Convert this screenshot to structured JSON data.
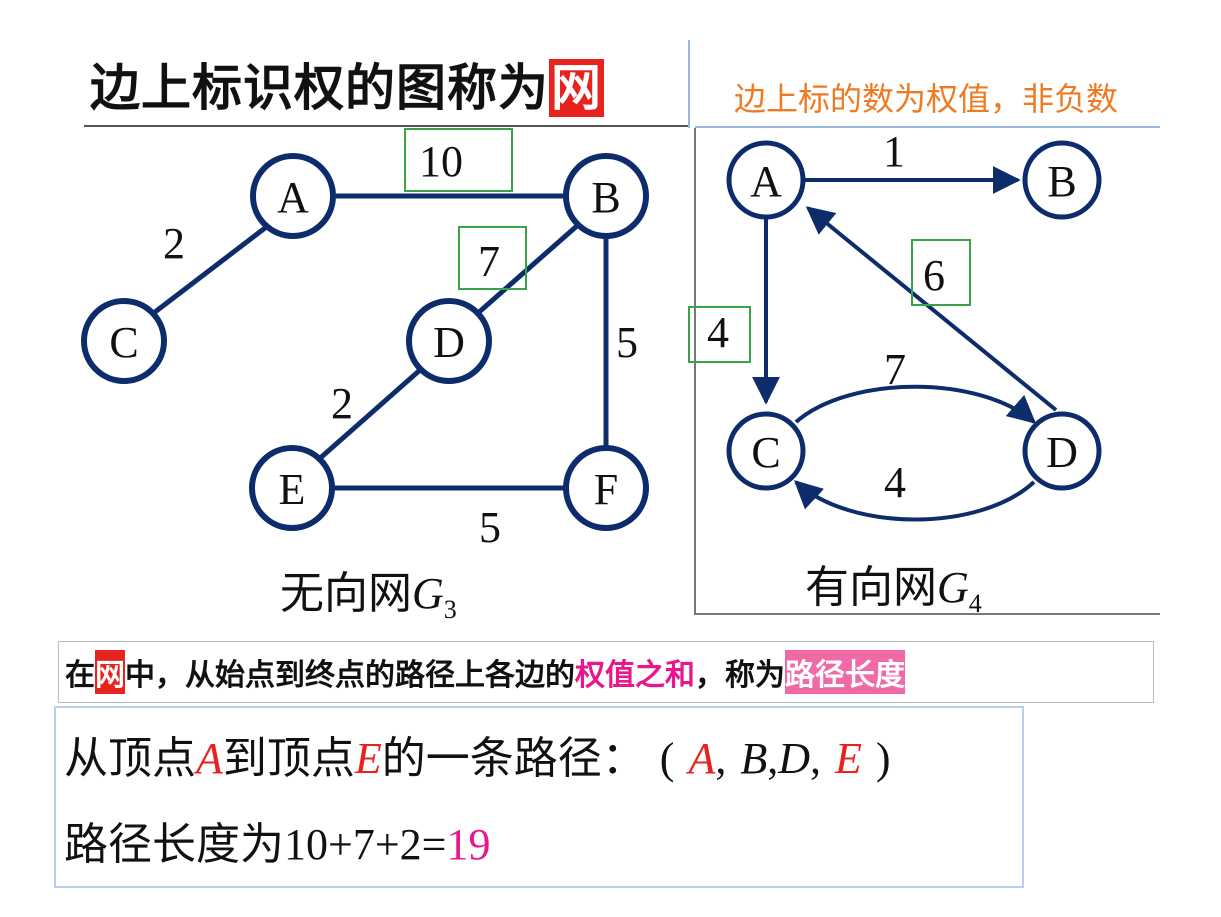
{
  "header": {
    "title_prefix": "边上标识权的图称为",
    "title_highlight": "网",
    "right_note": "边上标的数为权值，非负数"
  },
  "undirected": {
    "nodes": [
      "A",
      "B",
      "C",
      "D",
      "E",
      "F"
    ],
    "weights": {
      "AB": "10",
      "AC": "2",
      "BD": "7",
      "BF": "5",
      "DE": "2",
      "EF": "5"
    },
    "caption_text": "无向网",
    "caption_var": "G",
    "caption_sub": "3"
  },
  "directed": {
    "nodes": [
      "A",
      "B",
      "C",
      "D"
    ],
    "weights": {
      "AB": "1",
      "AC": "4",
      "DA": "6",
      "CD": "7",
      "DC": "4"
    },
    "caption_text": "有向网",
    "caption_var": "G",
    "caption_sub": "4"
  },
  "definition": {
    "p1": "在",
    "p2": "网",
    "p3": "中，从始点到终点的路径上各边的",
    "p4": "权值之和",
    "p5": "，称为",
    "p6": "路径长度"
  },
  "example": {
    "line1_a": "从顶点",
    "line1_A": "A",
    "line1_b": "到顶点",
    "line1_E": "E",
    "line1_c": "的一条路径：",
    "path_open": "(",
    "path_A": "A",
    "path_sep1": ",",
    "path_B": "B",
    "path_sep2": ",",
    "path_D": "D",
    "path_sep3": ",",
    "path_E": "E",
    "path_close": ")",
    "line2_label": "路径长度为",
    "line2_expr": "10+7+2=",
    "line2_result": "19"
  },
  "colors": {
    "edge": "#0d2c6b",
    "highlight_box": "#3aa34a",
    "accent_red": "#e8221d",
    "accent_pink": "#e8188c",
    "note_orange": "#ee7a22"
  }
}
